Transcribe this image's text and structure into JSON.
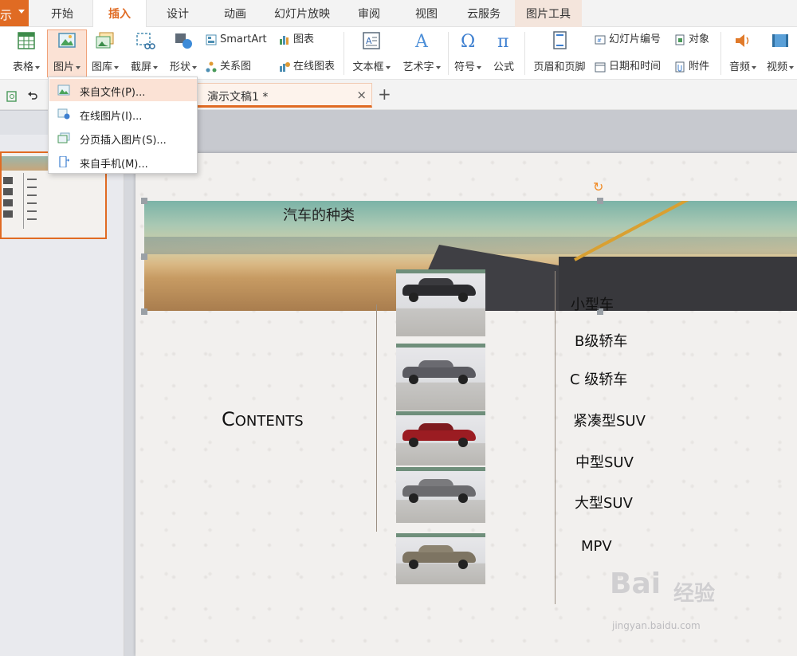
{
  "app_button": {
    "label": "示"
  },
  "tabs": [
    {
      "label": "开始"
    },
    {
      "label": "插入"
    },
    {
      "label": "设计"
    },
    {
      "label": "动画"
    },
    {
      "label": "幻灯片放映"
    },
    {
      "label": "审阅"
    },
    {
      "label": "视图"
    },
    {
      "label": "云服务"
    },
    {
      "label": "图片工具"
    }
  ],
  "active_tab": "插入",
  "ribbon": {
    "table": "表格",
    "picture": "图片",
    "gallery": "图库",
    "screenshot": "截屏",
    "shape": "形状",
    "smartart": "SmartArt",
    "relation": "关系图",
    "chart": "图表",
    "online_chart": "在线图表",
    "textbox": "文本框",
    "wordart": "艺术字",
    "symbol": "符号",
    "formula": "公式",
    "header_footer": "页眉和页脚",
    "slide_number": "幻灯片编号",
    "datetime": "日期和时间",
    "object": "对象",
    "attachment": "附件",
    "audio": "音频",
    "video": "视频"
  },
  "document_tab": {
    "title": "演示文稿1 *",
    "close": "×",
    "new_tab": "+"
  },
  "picture_menu": [
    {
      "label": "来自文件(P)..."
    },
    {
      "label": "在线图片(I)..."
    },
    {
      "label": "分页插入图片(S)..."
    },
    {
      "label": "来自手机(M)..."
    }
  ],
  "slide": {
    "banner_title": "汽车的种类",
    "contents_big": "C",
    "contents_rest": "ONTENTS",
    "items": [
      "小型车",
      "B级轿车",
      "C 级轿车",
      "紧凑型SUV",
      "中型SUV",
      "大型SUV",
      "MPV"
    ]
  },
  "watermark": {
    "brand": "Bai",
    "brand2": "经验",
    "url": "jingyan.baidu.com"
  },
  "colors": {
    "accent": "#e06b23",
    "menu_highlight": "#fbe2d5"
  }
}
